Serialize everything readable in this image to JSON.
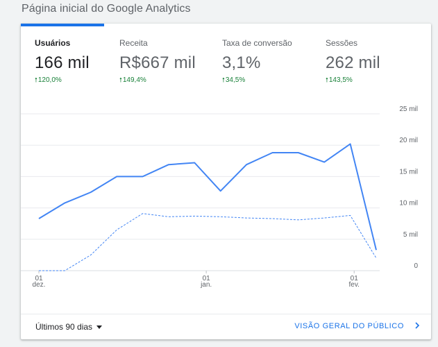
{
  "header": {
    "title": "Página inicial do Google Analytics"
  },
  "metrics": [
    {
      "label": "Usuários",
      "value": "166 mil",
      "delta": "120,0%",
      "active": true
    },
    {
      "label": "Receita",
      "value": "R$667 mil",
      "delta": "149,4%",
      "active": false
    },
    {
      "label": "Taxa de conversão",
      "value": "3,1%",
      "delta": "34,5%",
      "active": false
    },
    {
      "label": "Sessões",
      "value": "262 mil",
      "delta": "143,5%",
      "active": false
    }
  ],
  "colors": {
    "accent": "#1a73e8",
    "line": "#4285f4",
    "positive": "#188038"
  },
  "chart_data": {
    "type": "line",
    "ylim": [
      0,
      25000
    ],
    "y_ticks": [
      {
        "value": 25000,
        "label": "25 mil"
      },
      {
        "value": 20000,
        "label": "20 mil"
      },
      {
        "value": 15000,
        "label": "15 mil"
      },
      {
        "value": 10000,
        "label": "10 mil"
      },
      {
        "value": 5000,
        "label": "5 mil"
      },
      {
        "value": 0,
        "label": "0"
      }
    ],
    "x_ticks": [
      {
        "index": 0,
        "label": "01\ndez."
      },
      {
        "index": 6.45,
        "label": "01\njan."
      },
      {
        "index": 12.15,
        "label": "01\nfev."
      }
    ],
    "grid": true,
    "series": [
      {
        "style": "solid",
        "values": [
          8300,
          10800,
          12500,
          15000,
          15000,
          16900,
          17200,
          12700,
          16900,
          18800,
          18800,
          17300,
          20200,
          3300
        ]
      },
      {
        "style": "dashed",
        "values": [
          0,
          0,
          2500,
          6500,
          9100,
          8600,
          8700,
          8600,
          8400,
          8300,
          8100,
          8400,
          8800,
          2000
        ]
      }
    ]
  },
  "footer": {
    "range_label": "Últimos 90 dias",
    "link_label": "VISÃO GERAL DO PÚBLICO"
  },
  "icons": {
    "dropdown": "caret-down-icon",
    "link": "chevron-right-icon",
    "delta": "arrow-up-icon"
  }
}
